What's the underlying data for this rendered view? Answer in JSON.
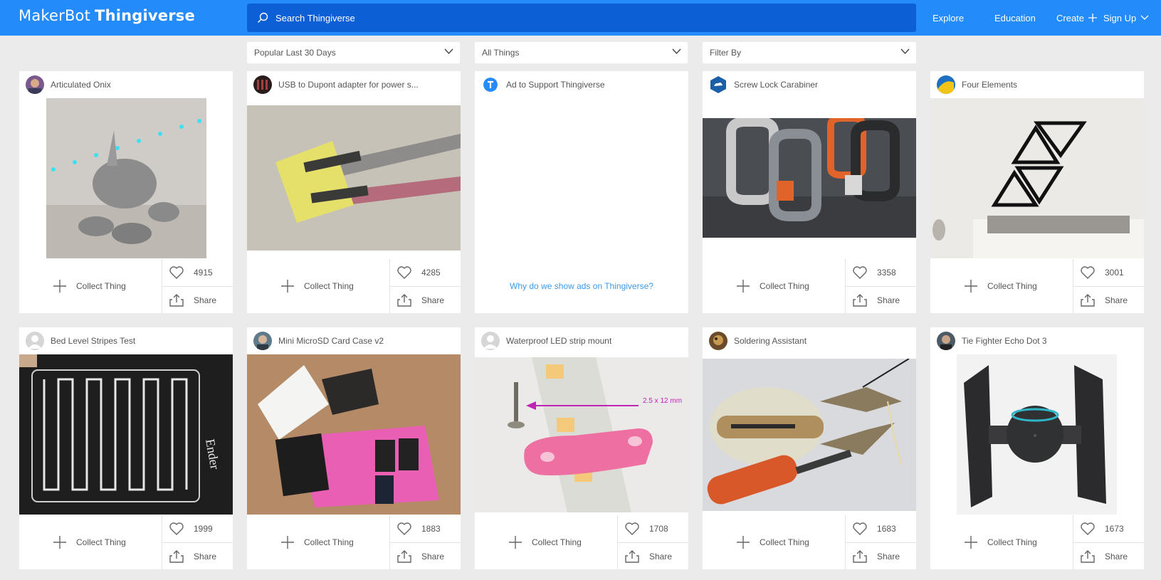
{
  "header": {
    "logo_makerbot": "MakerBot",
    "logo_thingiverse": "Thingiverse",
    "search_placeholder": "Search Thingiverse",
    "nav": {
      "explore": "Explore",
      "education": "Education",
      "create": "Create",
      "signup": "Sign Up"
    }
  },
  "filters": {
    "sort": "Popular Last 30 Days",
    "type": "All Things",
    "filter": "Filter By"
  },
  "actions": {
    "collect": "Collect Thing",
    "share": "Share"
  },
  "ad": {
    "title": "Ad to Support Thingiverse",
    "link": "Why do we show ads on Thingiverse?"
  },
  "things": [
    {
      "title": "Articulated Onix",
      "likes": "4915"
    },
    {
      "title": "USB to Dupont adapter for power s...",
      "likes": "4285"
    },
    {
      "title": "Screw Lock Carabiner",
      "likes": "3358"
    },
    {
      "title": "Four Elements",
      "likes": "3001"
    },
    {
      "title": "Bed Level Stripes Test",
      "likes": "1999"
    },
    {
      "title": "Mini MicroSD Card Case v2",
      "likes": "1883"
    },
    {
      "title": "Waterproof LED strip mount",
      "likes": "1708",
      "image_label": "2.5 x 12 mm"
    },
    {
      "title": "Soldering Assistant",
      "likes": "1683"
    },
    {
      "title": "Tie Fighter Echo Dot 3",
      "likes": "1673"
    }
  ],
  "colors": {
    "brand": "#248bfb",
    "search_bg": "#0d5fd6",
    "page_bg": "#ebebeb",
    "link": "#3d9ae8"
  }
}
